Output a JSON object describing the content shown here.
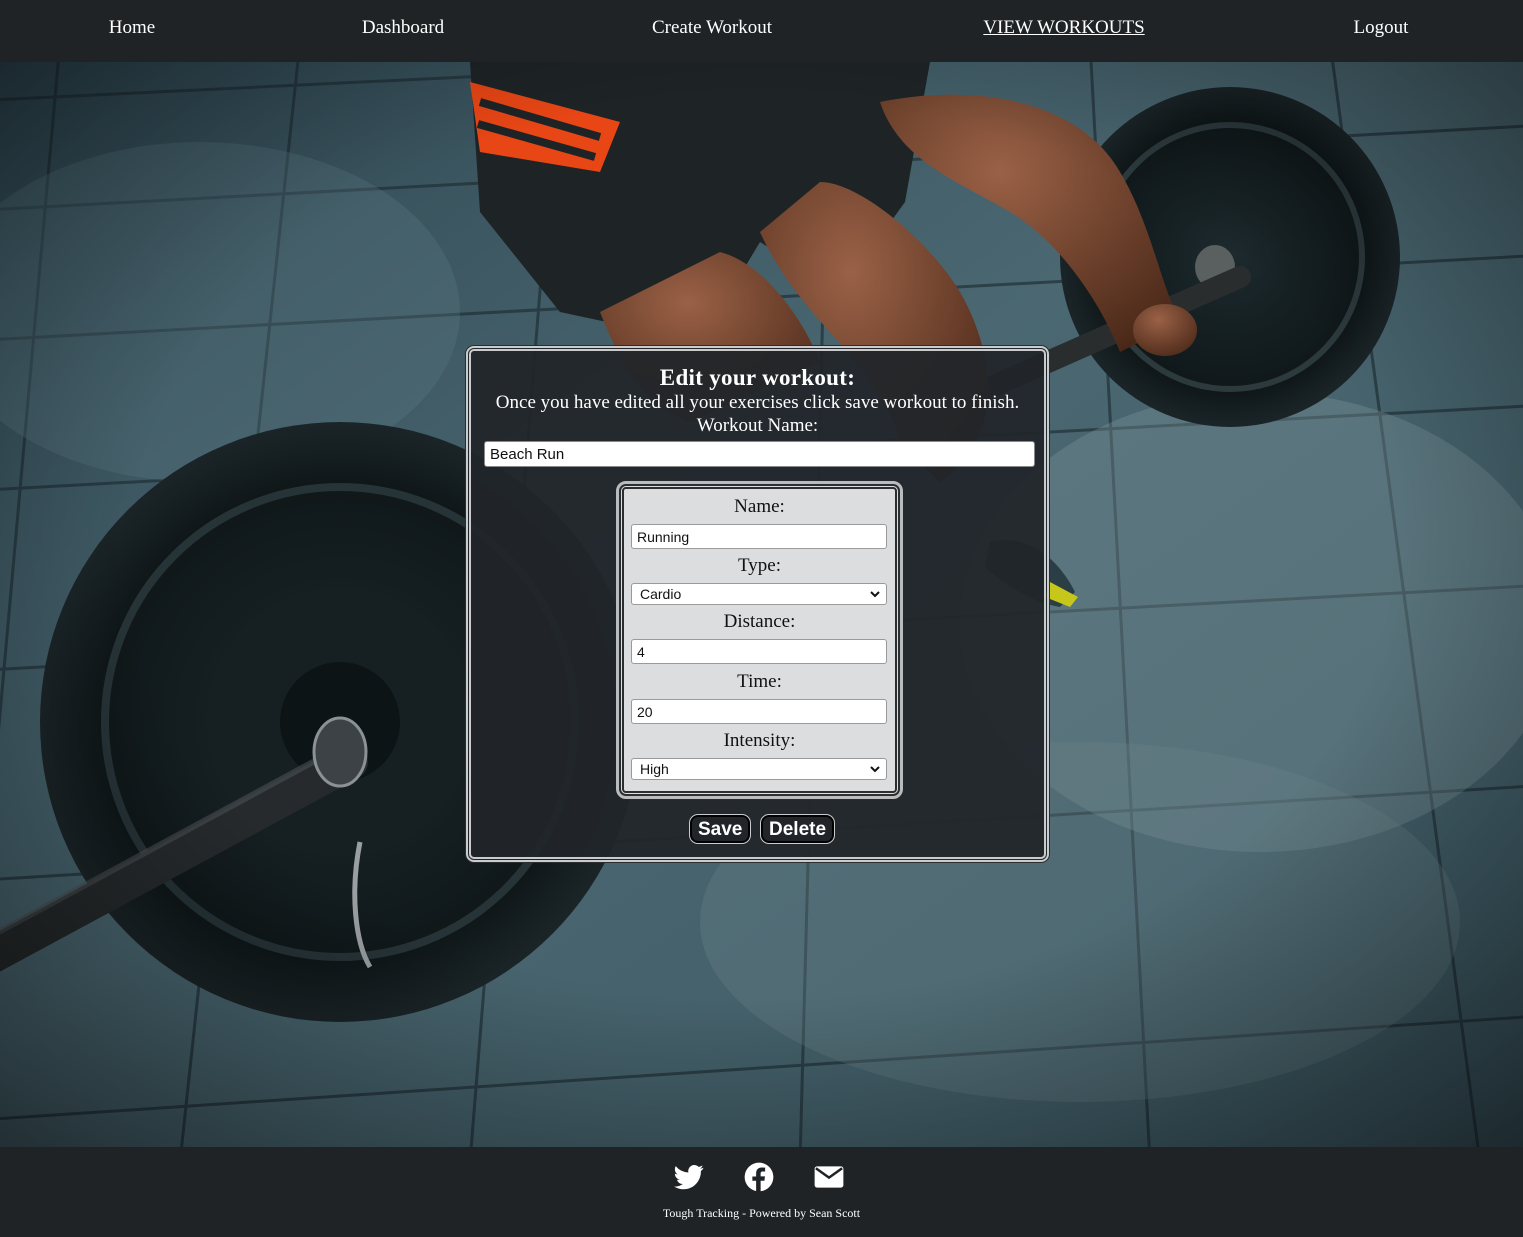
{
  "nav": {
    "items": [
      {
        "label": "Home",
        "active": false
      },
      {
        "label": "Dashboard",
        "active": false
      },
      {
        "label": "Create Workout",
        "active": false
      },
      {
        "label": "VIEW WORKOUTS",
        "active": true
      },
      {
        "label": "Logout",
        "active": false
      }
    ]
  },
  "edit": {
    "title": "Edit your workout:",
    "subtitle": "Once you have edited all your exercises click save workout to finish.",
    "workout_name_label": "Workout Name:",
    "workout_name_value": "Beach Run",
    "exercise": {
      "name_label": "Name:",
      "name_value": "Running",
      "type_label": "Type:",
      "type_value": "Cardio",
      "distance_label": "Distance:",
      "distance_value": "4",
      "time_label": "Time:",
      "time_value": "20",
      "intensity_label": "Intensity:",
      "intensity_value": "High"
    },
    "save_label": "Save",
    "delete_label": "Delete"
  },
  "footer": {
    "icons": [
      "twitter-icon",
      "facebook-icon",
      "email-icon"
    ],
    "text": "Tough Tracking - Powered by Sean Scott"
  },
  "colors": {
    "nav_bg": "#1f2326",
    "card_bg": "#212529",
    "exercise_bg": "#dcdddf",
    "accent_orange": "#ff4a14"
  }
}
